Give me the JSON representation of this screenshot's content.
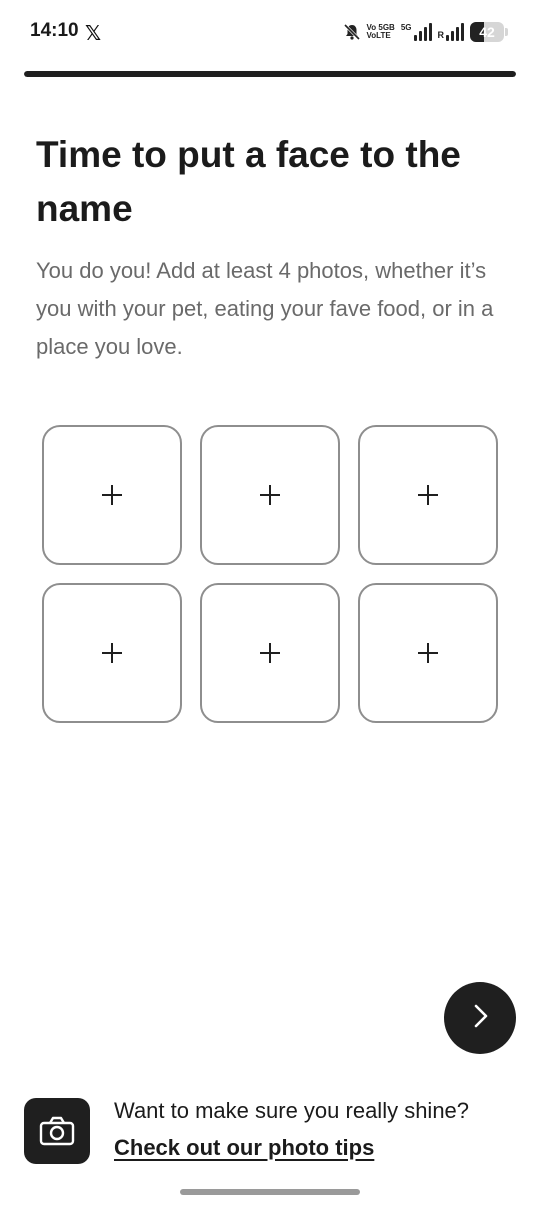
{
  "status_bar": {
    "time": "14:10",
    "x_logo": "𝕏",
    "volte_top": "Vo 5GB",
    "volte_bottom": "VoLTE",
    "sim1_label": "5G",
    "roaming_label": "R",
    "battery": "42",
    "battery_level": 0.42,
    "icons": [
      "x-app-icon",
      "mute-icon",
      "volte-icon",
      "signal-5g-icon",
      "signal-roaming-icon",
      "battery-icon"
    ]
  },
  "progress": {
    "fraction": 1.0
  },
  "content": {
    "title": "Time to put a face to the name",
    "subtitle": "You do you! Add at least 4 photos, whether it’s you with your pet, eating your fave food, or in a place you love."
  },
  "photo_slots": [
    {
      "icon": "plus-icon"
    },
    {
      "icon": "plus-icon"
    },
    {
      "icon": "plus-icon"
    },
    {
      "icon": "plus-icon"
    },
    {
      "icon": "plus-icon"
    },
    {
      "icon": "plus-icon"
    }
  ],
  "next_button": {
    "icon": "chevron-right-icon"
  },
  "tips": {
    "icon": "camera-icon",
    "question": "Want to make sure you really shine?",
    "link": "Check out our photo tips"
  },
  "colors": {
    "primary_dark": "#1f1f1f",
    "slot_border": "#8e8e8e",
    "subtitle": "#6a6a6a",
    "background": "#ffffff"
  }
}
